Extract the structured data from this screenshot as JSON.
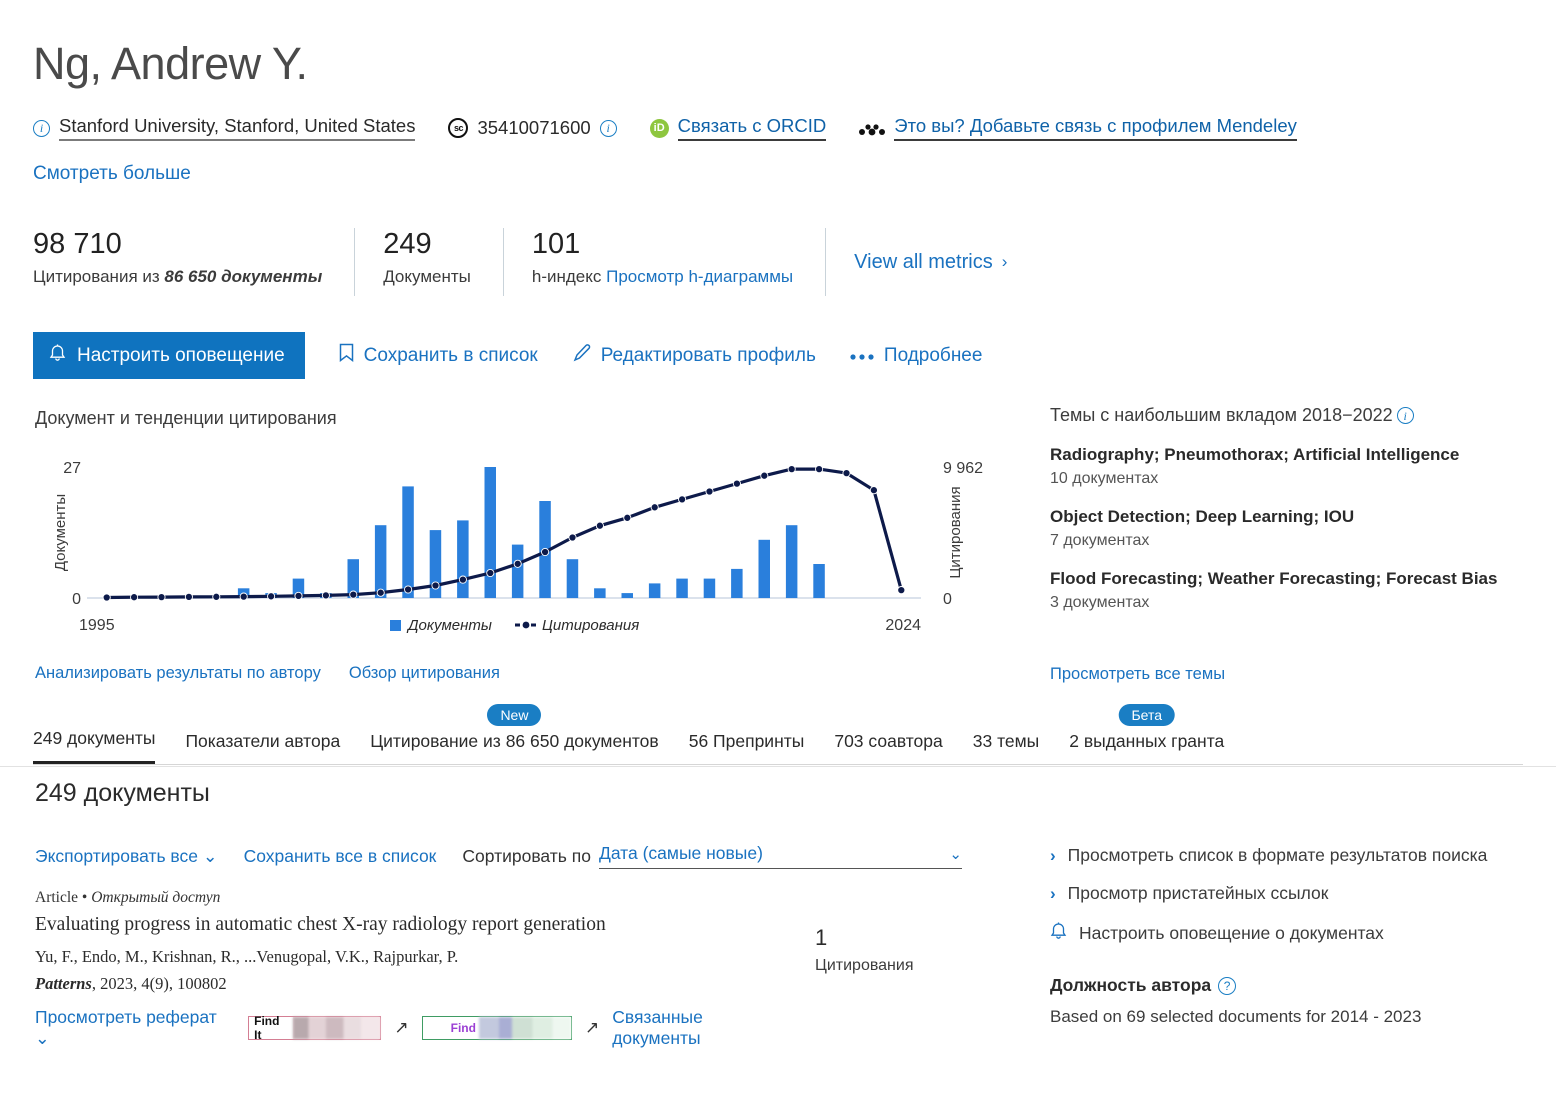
{
  "header": {
    "author_name": "Ng, Andrew Y.",
    "affiliation": "Stanford University, Stanford, United States",
    "scopus_id": "35410071600",
    "orcid_link": "Связать с ORCID",
    "mendeley_link": "Это вы? Добавьте связь с профилем Mendeley",
    "see_more": "Смотреть больше",
    "icons": {
      "info": "info-icon",
      "scopus": "scopus-icon",
      "orcid": "orcid-icon",
      "mendeley": "mendeley-icon"
    }
  },
  "metrics": {
    "citations_value": "98 710",
    "citations_label_prefix": "Цитирования из ",
    "citations_label_em": "86 650 документы",
    "documents_value": "249",
    "documents_label": "Документы",
    "hindex_value": "101",
    "hindex_label": "h-индекс ",
    "hindex_link": "Просмотр h-диаграммы",
    "view_all": "View all metrics",
    "chevron": "›"
  },
  "actions": {
    "set_alert": "Настроить оповещение",
    "save_to_list": "Сохранить в список",
    "edit_profile": "Редактировать профиль",
    "more": "Подробнее"
  },
  "chart_panel": {
    "title": "Документ и тенденции цитирования",
    "link_analyze": "Анализировать результаты по автору",
    "link_overview": "Обзор цитирования"
  },
  "chart_data": {
    "type": "bar",
    "title": "Документ и тенденции цитирования",
    "xlabel": "",
    "ylabel": "Документы",
    "y2label": "Цитирования",
    "x_tick_first": "1995",
    "x_tick_last": "2024",
    "ylim": [
      0,
      27
    ],
    "y_ticks": [
      "0",
      "27"
    ],
    "y2lim": [
      0,
      9962
    ],
    "y2_ticks": [
      "0",
      "9 962"
    ],
    "grid": false,
    "legend": [
      "Документы",
      "Цитирования"
    ],
    "legend_position": "bottom-center",
    "colors": {
      "bars": "#2a7fdc",
      "line": "#0d1a4a"
    },
    "categories": [
      1995,
      1996,
      1997,
      1998,
      1999,
      2000,
      2001,
      2002,
      2003,
      2004,
      2005,
      2006,
      2007,
      2008,
      2009,
      2010,
      2011,
      2012,
      2013,
      2014,
      2015,
      2016,
      2017,
      2018,
      2019,
      2020,
      2021,
      2022,
      2023,
      2024
    ],
    "series": [
      {
        "name": "Документы",
        "axis": "left",
        "values": [
          0,
          0,
          0,
          0,
          0,
          2,
          1,
          4,
          1,
          8,
          15,
          23,
          14,
          16,
          27,
          11,
          20,
          8,
          2,
          1,
          3,
          4,
          4,
          6,
          12,
          15,
          7,
          0,
          0,
          0
        ]
      },
      {
        "name": "Цитирования",
        "axis": "right",
        "values": [
          40,
          60,
          70,
          80,
          90,
          110,
          130,
          160,
          200,
          260,
          400,
          650,
          950,
          1400,
          1900,
          2600,
          3500,
          4600,
          5500,
          6100,
          6900,
          7500,
          8100,
          8700,
          9300,
          9800,
          9800,
          9500,
          8200,
          600
        ]
      }
    ]
  },
  "topics": {
    "heading": "Темы с наибольшим вкладом 2018−2022",
    "items": [
      {
        "name": "Radiography; Pneumothorax; Artificial Intelligence",
        "count": "10 документах"
      },
      {
        "name": "Object Detection; Deep Learning; IOU",
        "count": "7 документах"
      },
      {
        "name": "Flood Forecasting; Weather Forecasting; Forecast Bias",
        "count": "3 документах"
      }
    ],
    "view_all": "Просмотреть все темы"
  },
  "tabs": [
    {
      "label": "249 документы",
      "active": true,
      "badge": ""
    },
    {
      "label": "Показатели автора",
      "active": false,
      "badge": ""
    },
    {
      "label": "Цитирование из 86 650 документов",
      "active": false,
      "badge": "New"
    },
    {
      "label": "56 Препринты",
      "active": false,
      "badge": ""
    },
    {
      "label": "703 соавтора",
      "active": false,
      "badge": ""
    },
    {
      "label": "33 темы",
      "active": false,
      "badge": ""
    },
    {
      "label": "2 выданных гранта",
      "active": false,
      "badge": "Бета"
    }
  ],
  "docs": {
    "count_heading": "249 документы",
    "export_all": "Экспортировать все",
    "save_all": "Сохранить все в список",
    "sort_label": "Сортировать по",
    "sort_value": "Дата (самые новые)",
    "item": {
      "type": "Article",
      "bullet": "•",
      "access": "Открытый доступ",
      "title": "Evaluating progress in automatic chest X-ray radiology report generation",
      "authors": "Yu, F., Endo, M., Krishnan, R., ...Venugopal, V.K., Rajpurkar, P.",
      "source_journal": "Patterns",
      "source_rest": ", 2023, 4(9), 100802",
      "view_abstract": "Просмотреть реферат",
      "findit_label": "Find It",
      "findit2_label": "Find",
      "related": "Связанные документы",
      "citations_value": "1",
      "citations_label": "Цитирования"
    }
  },
  "rail": {
    "view_as_search": "Просмотреть список в формате результатов поиска",
    "view_references": "Просмотр пристатейных ссылок",
    "set_doc_alert": "Настроить оповещение о документах",
    "position_head": "Должность автора",
    "position_sub": "Based on 69 selected documents for 2014 - 2023"
  }
}
